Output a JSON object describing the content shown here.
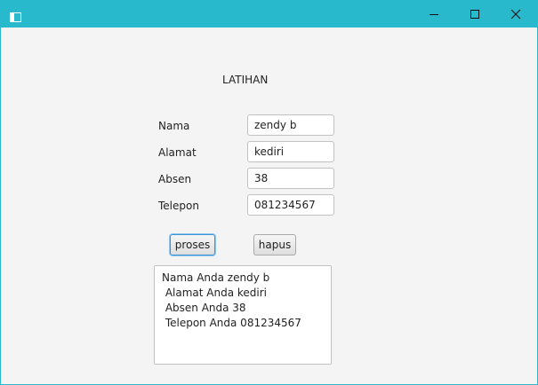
{
  "window": {
    "title": "",
    "accent": "#29b9cd",
    "icons": {
      "app": "window-app-icon",
      "minimize": "minimize-icon",
      "maximize": "maximize-icon",
      "close": "close-icon"
    }
  },
  "form": {
    "heading": "LATIHAN",
    "fields": [
      {
        "label": "Nama",
        "value": "zendy b"
      },
      {
        "label": "Alamat",
        "value": "kediri"
      },
      {
        "label": "Absen",
        "value": "38"
      },
      {
        "label": "Telepon",
        "value": "081234567"
      }
    ],
    "buttons": {
      "proses": "proses",
      "hapus": "hapus"
    },
    "output_lines": [
      "Nama Anda zendy b",
      " Alamat Anda kediri",
      " Absen Anda 38",
      " Telepon Anda 081234567"
    ]
  }
}
